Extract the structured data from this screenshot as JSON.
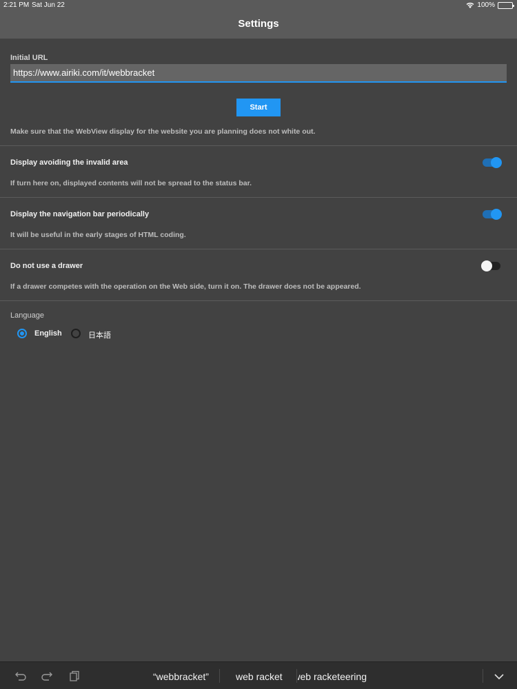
{
  "status_bar": {
    "time": "2:21 PM",
    "date": "Sat Jun 22",
    "battery": "100%"
  },
  "nav": {
    "title": "Settings"
  },
  "initial_url": {
    "label": "Initial URL",
    "value": "https://www.airiki.com/it/webbracket"
  },
  "start_button": {
    "label": "Start"
  },
  "url_note": "Make sure that the WebView display for the website you are planning does not white out.",
  "options": [
    {
      "title": "Display avoiding the invalid area",
      "description": "If turn here on, displayed contents will not be spread to the status bar.",
      "enabled": true
    },
    {
      "title": "Display the navigation bar periodically",
      "description": "It will be useful in the early stages of HTML coding.",
      "enabled": true
    },
    {
      "title": "Do not use a drawer",
      "description": "If a drawer competes with the operation on the Web side, turn it on. The drawer does not be appeared.",
      "enabled": false
    }
  ],
  "language": {
    "label": "Language",
    "options": [
      "English",
      "日本語"
    ],
    "selected": "English"
  },
  "keyboard": {
    "suggestions": [
      "“webbracket”",
      "web racket",
      "web racketeering"
    ]
  },
  "colors": {
    "accent": "#2196f3",
    "background": "#424242",
    "topbar": "#5a5a5a"
  }
}
